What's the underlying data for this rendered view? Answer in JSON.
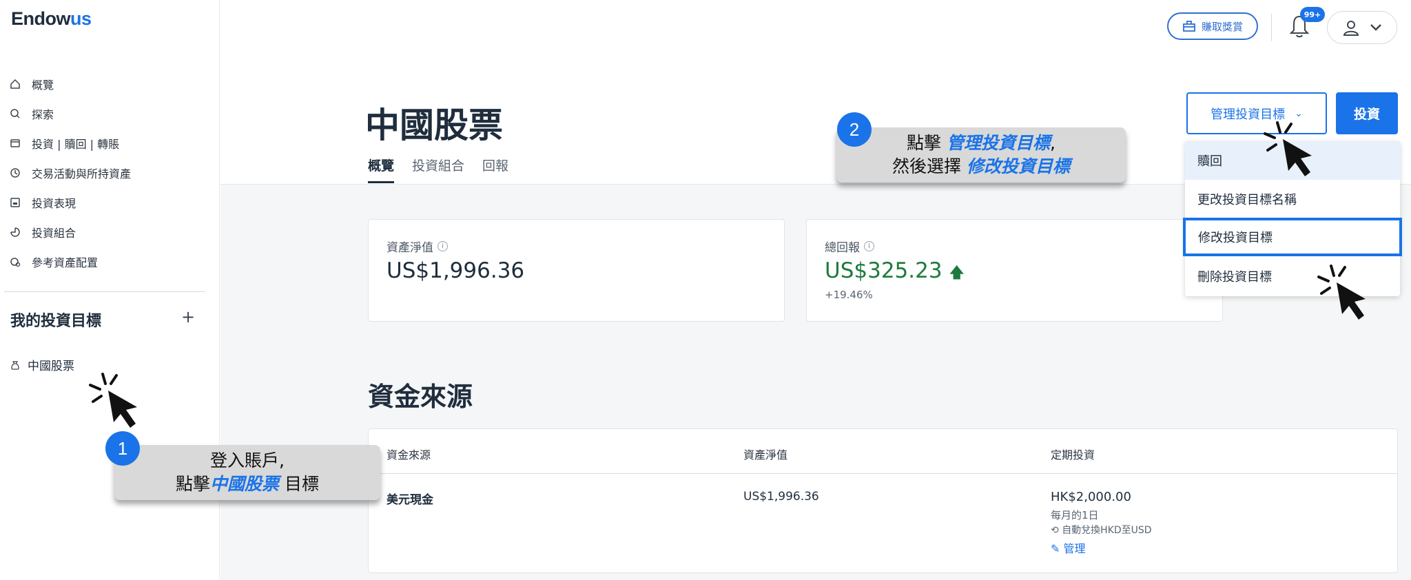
{
  "brand": {
    "prefix": "Endow",
    "suffix": "us"
  },
  "sidebar": {
    "nav": [
      {
        "label": "概覽",
        "icon": "home-icon"
      },
      {
        "label": "探索",
        "icon": "search-icon"
      },
      {
        "label": "投資 | 贖回 | 轉賬",
        "icon": "wallet-icon"
      },
      {
        "label": "交易活動與所持資產",
        "icon": "clock-icon"
      },
      {
        "label": "投資表現",
        "icon": "chart-icon"
      },
      {
        "label": "投資組合",
        "icon": "pie-icon"
      },
      {
        "label": "參考資產配置",
        "icon": "allocation-icon"
      }
    ],
    "goals_title": "我的投資目標",
    "add_symbol": "+",
    "goal_item": "中國股票"
  },
  "topbar": {
    "rewards_label": "賺取獎賞",
    "notifications_badge": "99+"
  },
  "header": {
    "title": "中國股票",
    "tabs": [
      "概覽",
      "投資組合",
      "回報"
    ],
    "manage_label": "管理投資目標",
    "chevron": "⌄",
    "invest_label": "投資"
  },
  "dropdown": {
    "items": [
      "贖回",
      "更改投資目標名稱",
      "修改投資目標",
      "刪除投資目標"
    ]
  },
  "cards": {
    "nav_label": "資產淨值",
    "nav_value": "US$1,996.36",
    "return_label": "總回報",
    "return_value": "US$325.23",
    "return_pct": "+19.46%",
    "info_symbol": "i",
    "up_arrow": "🡅"
  },
  "funding": {
    "title": "資金來源",
    "headers": [
      "資金來源",
      "資產淨值",
      "定期投資"
    ],
    "row": {
      "source": "美元現金",
      "nav": "US$1,996.36",
      "recurring_amount": "HK$2,000.00",
      "recurring_schedule": "每月的1日",
      "auto_convert": "自動兌換HKD至USD",
      "manage_link": "管理"
    }
  },
  "callouts": {
    "step1": {
      "number": "1",
      "line1": "登入賬戶,",
      "pre": "點擊",
      "highlight": "中國股票",
      "post": " 目標"
    },
    "step2": {
      "number": "2",
      "pre": "點擊 ",
      "highlight": "管理投資目標",
      "post": ",",
      "line2_pre": "然後選擇 ",
      "line2_highlight": "修改投資目標"
    }
  },
  "colors": {
    "accent": "#1a73e8",
    "positive": "#1e7a3c",
    "callout_bg": "#d9d9d9"
  }
}
